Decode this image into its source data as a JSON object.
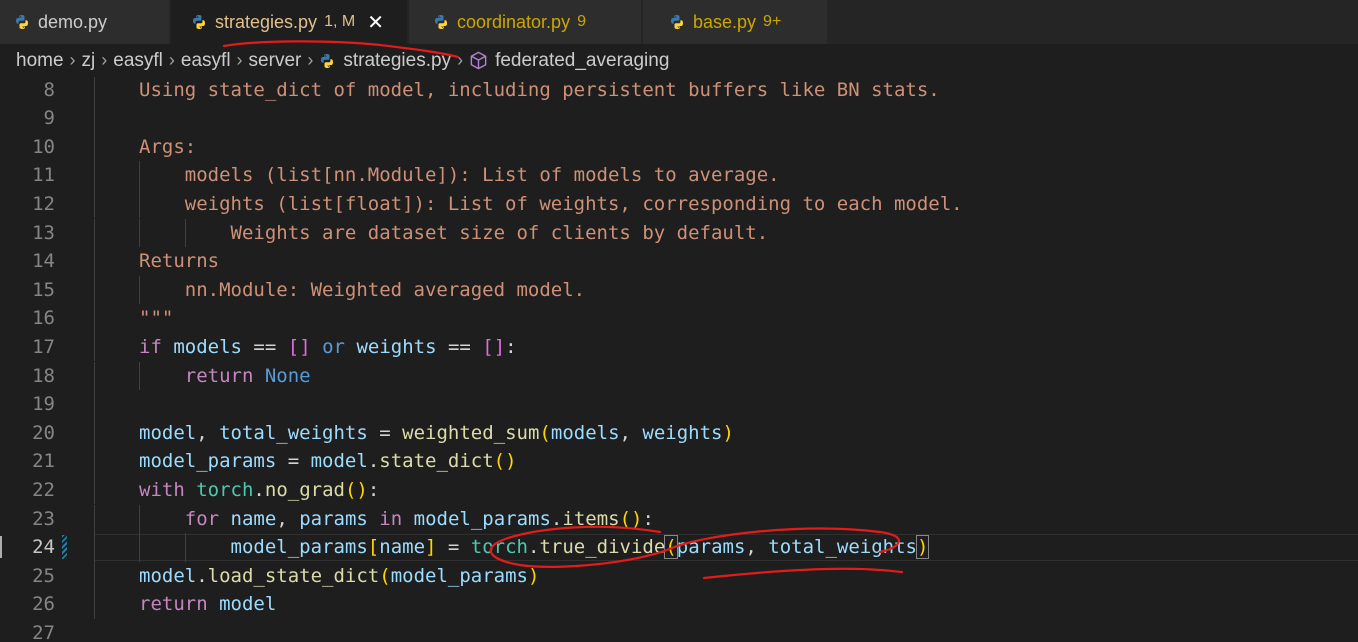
{
  "tabs": [
    {
      "label": "demo.py",
      "status": "",
      "label_color": "#cccccc",
      "status_color": "#cccccc",
      "active": false
    },
    {
      "label": "strategies.py",
      "status": "1, M",
      "label_color": "#e2c08d",
      "status_color": "#e2c08d",
      "active": true
    },
    {
      "label": "coordinator.py",
      "status": "9",
      "label_color": "#cca700",
      "status_color": "#cca700",
      "active": false
    },
    {
      "label": "base.py",
      "status": "9+",
      "label_color": "#cca700",
      "status_color": "#cca700",
      "active": false
    }
  ],
  "tab_close_symbol": "✕",
  "breadcrumb": {
    "items": [
      "home",
      "zj",
      "easyfl",
      "easyfl",
      "server",
      "strategies.py",
      "federated_averaging"
    ],
    "separator": "›"
  },
  "icons": {
    "python_file": "python-icon",
    "symbol_method": "cube-icon",
    "close": "close-icon"
  },
  "colors": {
    "python_blue": "#3c78aa",
    "python_yellow": "#ffd43b",
    "method_purple": "#b180d7",
    "annotation_red": "#e31b1b",
    "modified_gutter": "#1b81a8"
  },
  "editor": {
    "current_line": 24,
    "lines": [
      {
        "num": "8",
        "indent": 1,
        "tokens": [
          {
            "t": "Using state_dict of model, including persistent buffers like BN stats.",
            "c": "t-doc"
          }
        ]
      },
      {
        "num": "9",
        "indent": 1,
        "tokens": []
      },
      {
        "num": "10",
        "indent": 1,
        "tokens": [
          {
            "t": "Args:",
            "c": "t-doc"
          }
        ]
      },
      {
        "num": "11",
        "indent": 2,
        "tokens": [
          {
            "t": "    models (list[nn.Module]): List of models to average.",
            "c": "t-doc"
          }
        ]
      },
      {
        "num": "12",
        "indent": 2,
        "tokens": [
          {
            "t": "    weights (list[float]): List of weights, corresponding to each model.",
            "c": "t-doc"
          }
        ]
      },
      {
        "num": "13",
        "indent": 3,
        "tokens": [
          {
            "t": "        Weights are dataset size of clients by default.",
            "c": "t-doc"
          }
        ]
      },
      {
        "num": "14",
        "indent": 1,
        "tokens": [
          {
            "t": "Returns",
            "c": "t-doc"
          }
        ]
      },
      {
        "num": "15",
        "indent": 2,
        "tokens": [
          {
            "t": "    nn.Module: Weighted averaged model.",
            "c": "t-doc"
          }
        ]
      },
      {
        "num": "16",
        "indent": 1,
        "tokens": [
          {
            "t": "\"\"\"",
            "c": "t-doc"
          }
        ]
      },
      {
        "num": "17",
        "indent": 1,
        "tokens": [
          {
            "t": "if",
            "c": "t-kw"
          },
          {
            "t": " ",
            "c": "t-op"
          },
          {
            "t": "models",
            "c": "t-var"
          },
          {
            "t": " == ",
            "c": "t-op"
          },
          {
            "t": "[]",
            "c": "t-br2"
          },
          {
            "t": " ",
            "c": "t-op"
          },
          {
            "t": "or",
            "c": "t-bl"
          },
          {
            "t": " ",
            "c": "t-op"
          },
          {
            "t": "weights",
            "c": "t-var"
          },
          {
            "t": " == ",
            "c": "t-op"
          },
          {
            "t": "[]",
            "c": "t-br2"
          },
          {
            "t": ":",
            "c": "t-op"
          }
        ]
      },
      {
        "num": "18",
        "indent": 2,
        "tokens": [
          {
            "t": "    ",
            "c": "t-op"
          },
          {
            "t": "return",
            "c": "t-kw"
          },
          {
            "t": " ",
            "c": "t-op"
          },
          {
            "t": "None",
            "c": "t-bl"
          }
        ]
      },
      {
        "num": "19",
        "indent": 1,
        "tokens": []
      },
      {
        "num": "20",
        "indent": 1,
        "tokens": [
          {
            "t": "model",
            "c": "t-var"
          },
          {
            "t": ", ",
            "c": "t-op"
          },
          {
            "t": "total_weights",
            "c": "t-var"
          },
          {
            "t": " = ",
            "c": "t-op"
          },
          {
            "t": "weighted_sum",
            "c": "t-fn"
          },
          {
            "t": "(",
            "c": "t-br1"
          },
          {
            "t": "models",
            "c": "t-var"
          },
          {
            "t": ", ",
            "c": "t-op"
          },
          {
            "t": "weights",
            "c": "t-var"
          },
          {
            "t": ")",
            "c": "t-br1"
          }
        ]
      },
      {
        "num": "21",
        "indent": 1,
        "tokens": [
          {
            "t": "model_params",
            "c": "t-var"
          },
          {
            "t": " = ",
            "c": "t-op"
          },
          {
            "t": "model",
            "c": "t-var"
          },
          {
            "t": ".",
            "c": "t-op"
          },
          {
            "t": "state_dict",
            "c": "t-fn"
          },
          {
            "t": "()",
            "c": "t-br1"
          }
        ]
      },
      {
        "num": "22",
        "indent": 1,
        "tokens": [
          {
            "t": "with",
            "c": "t-kw"
          },
          {
            "t": " ",
            "c": "t-op"
          },
          {
            "t": "torch",
            "c": "t-mod"
          },
          {
            "t": ".",
            "c": "t-op"
          },
          {
            "t": "no_grad",
            "c": "t-fn"
          },
          {
            "t": "()",
            "c": "t-br1"
          },
          {
            "t": ":",
            "c": "t-op"
          }
        ]
      },
      {
        "num": "23",
        "indent": 2,
        "tokens": [
          {
            "t": "    ",
            "c": "t-op"
          },
          {
            "t": "for",
            "c": "t-kw"
          },
          {
            "t": " ",
            "c": "t-op"
          },
          {
            "t": "name",
            "c": "t-var"
          },
          {
            "t": ", ",
            "c": "t-op"
          },
          {
            "t": "params",
            "c": "t-var"
          },
          {
            "t": " ",
            "c": "t-op"
          },
          {
            "t": "in",
            "c": "t-kw"
          },
          {
            "t": " ",
            "c": "t-op"
          },
          {
            "t": "model_params",
            "c": "t-var"
          },
          {
            "t": ".",
            "c": "t-op"
          },
          {
            "t": "items",
            "c": "t-fn"
          },
          {
            "t": "()",
            "c": "t-br1"
          },
          {
            "t": ":",
            "c": "t-op"
          }
        ]
      },
      {
        "num": "24",
        "indent": 3,
        "tokens": [
          {
            "t": "        ",
            "c": "t-op"
          },
          {
            "t": "model_params",
            "c": "t-var"
          },
          {
            "t": "[",
            "c": "t-br1"
          },
          {
            "t": "name",
            "c": "t-var"
          },
          {
            "t": "]",
            "c": "t-br1"
          },
          {
            "t": " = ",
            "c": "t-op"
          },
          {
            "t": "torch",
            "c": "t-mod"
          },
          {
            "t": ".",
            "c": "t-op"
          },
          {
            "t": "true_divide",
            "c": "t-fn"
          },
          {
            "t": "(",
            "c": "t-br1-match"
          },
          {
            "t": "params",
            "c": "t-var"
          },
          {
            "t": ", ",
            "c": "t-op"
          },
          {
            "t": "total_weights",
            "c": "t-var"
          },
          {
            "t": ")",
            "c": "t-br1-match"
          }
        ]
      },
      {
        "num": "25",
        "indent": 1,
        "tokens": [
          {
            "t": "model",
            "c": "t-var"
          },
          {
            "t": ".",
            "c": "t-op"
          },
          {
            "t": "load_state_dict",
            "c": "t-fn"
          },
          {
            "t": "(",
            "c": "t-br1"
          },
          {
            "t": "model_params",
            "c": "t-var"
          },
          {
            "t": ")",
            "c": "t-br1"
          }
        ]
      },
      {
        "num": "26",
        "indent": 1,
        "tokens": [
          {
            "t": "return",
            "c": "t-kw"
          },
          {
            "t": " ",
            "c": "t-op"
          },
          {
            "t": "model",
            "c": "t-var"
          }
        ]
      },
      {
        "num": "27",
        "indent": 0,
        "tokens": []
      }
    ]
  }
}
